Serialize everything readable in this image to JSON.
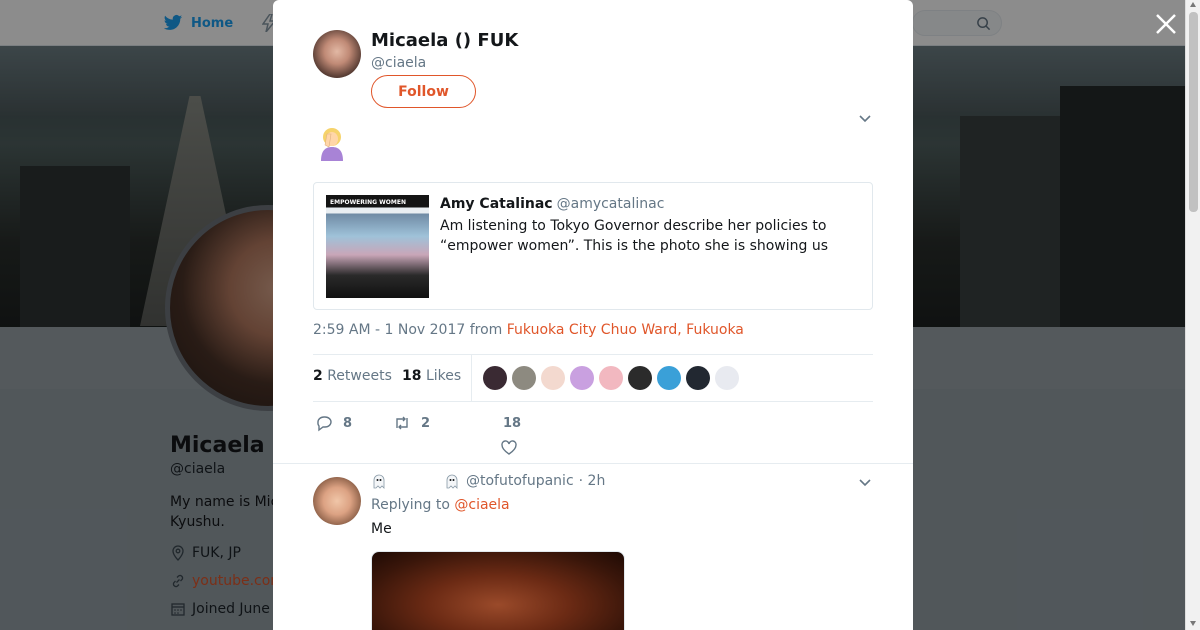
{
  "colors": {
    "accent": "#e0562a",
    "twitter_blue": "#1da1f2",
    "secondary_text": "#657786",
    "primary_text": "#14171a"
  },
  "topnav": {
    "home_label": "Home",
    "home_icon": "twitter-bird-icon",
    "notifications_icon": "lightning-icon",
    "search_icon": "search-icon"
  },
  "background_profile": {
    "name": "Micaela (",
    "handle": "@ciaela",
    "bio": "My name is Mic Kyushu.",
    "location": "FUK, JP",
    "website": "youtube.com",
    "joined": "Joined June",
    "location_icon": "location-pin-icon",
    "link_icon": "link-icon",
    "calendar_icon": "calendar-icon"
  },
  "modal": {
    "close_icon": "close-icon",
    "tweet": {
      "name": "Micaela () FUK",
      "handle": "@ciaela",
      "follow_label": "Follow",
      "emoji": "woman-facepalming-emoji",
      "quoted": {
        "name": "Amy Catalinac",
        "handle": "@amycatalinac",
        "text": "Am listening to Tokyo Governor describe her policies to “empower women”.  This is the photo she is showing us",
        "image_caption": "EMPOWERING WOMEN"
      },
      "timestamp": "2:59 AM - 1 Nov 2017 from",
      "place": "Fukuoka City Chuo Ward, Fukuoka",
      "retweets_count": "2",
      "retweets_label": "Retweets",
      "likes_count": "18",
      "likes_label": "Likes",
      "likers": [
        {
          "color": "#3a2a33"
        },
        {
          "color": "#8d8a80"
        },
        {
          "color": "#f3d9cf"
        },
        {
          "color": "#c9a0e0"
        },
        {
          "color": "#f2b8c0"
        },
        {
          "color": "#2b2b2b"
        },
        {
          "color": "#3aa0d8"
        },
        {
          "color": "#222831"
        },
        {
          "color": "#e8eaf0"
        }
      ],
      "actions": {
        "reply_count": "8",
        "retweet_count": "2",
        "like_count": "18"
      }
    },
    "reply": {
      "handle": "@tofutofupanic",
      "time": "· 2h",
      "replying_prefix": "Replying to",
      "replying_to": "@ciaela",
      "text": "Me"
    }
  }
}
